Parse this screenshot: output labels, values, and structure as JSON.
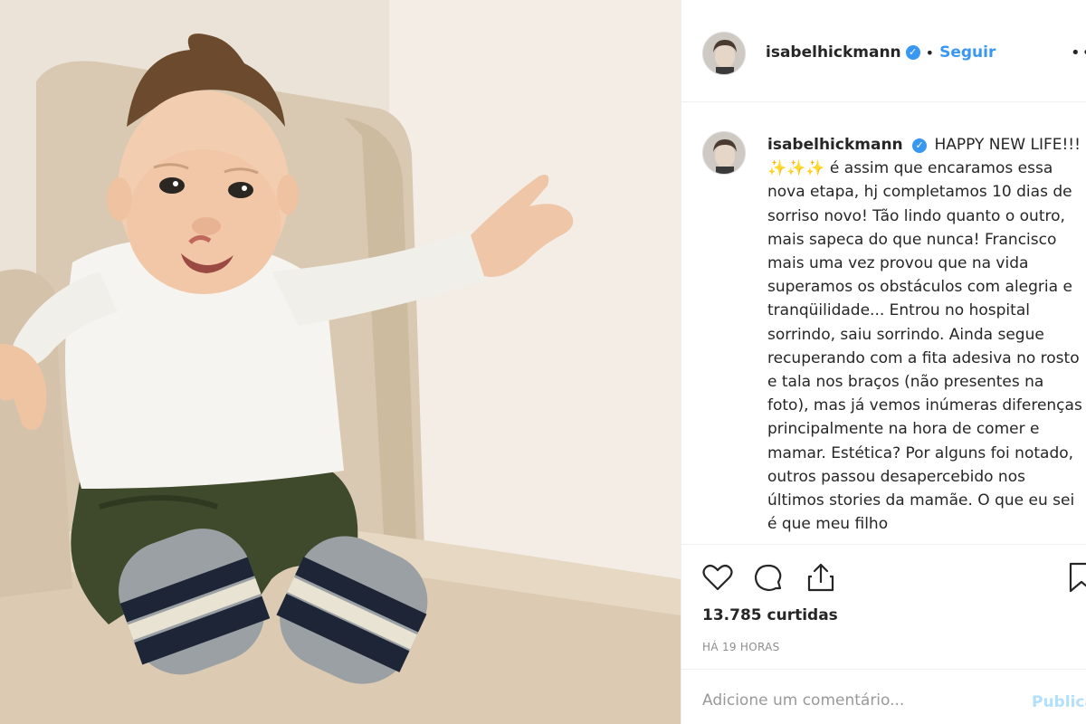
{
  "post": {
    "photo_alt": "",
    "username": "isabelhickmann",
    "verified_mark": "✓",
    "separator": "•",
    "follow_label": "Seguir",
    "more_label": "•••",
    "caption_sparkles": "✨✨✨",
    "caption_line1": "HAPPY NEW LIFE!!!",
    "caption_body": "é assim que encaramos essa nova etapa, hj completamos 10 dias de sorriso novo! Tão lindo quanto o outro, mais sapeca do que nunca! Francisco mais uma vez provou que na vida superamos os obstáculos com alegria e tranqüilidade... Entrou no hospital sorrindo, saiu sorrindo. Ainda segue recuperando com a fita adesiva no rosto e tala nos braços (não presentes na foto), mas já vemos inúmeras diferenças principalmente na hora de comer e mamar. Estética? Por alguns foi notado, outros passou desapercebido nos últimos stories da mamãe. O que eu sei é que meu filho",
    "likes": "13.785 curtidas",
    "timestamp": "HÁ 19 HORAS",
    "comment_placeholder": "Adicione um comentário...",
    "publish_label": "Publicar"
  },
  "icons": {
    "like": "heart-icon",
    "comment": "comment-icon",
    "share": "share-icon",
    "save": "bookmark-icon"
  },
  "colors": {
    "accent": "#3897f0",
    "publish_disabled": "#b2dffc",
    "muted": "#8e8e8e"
  }
}
